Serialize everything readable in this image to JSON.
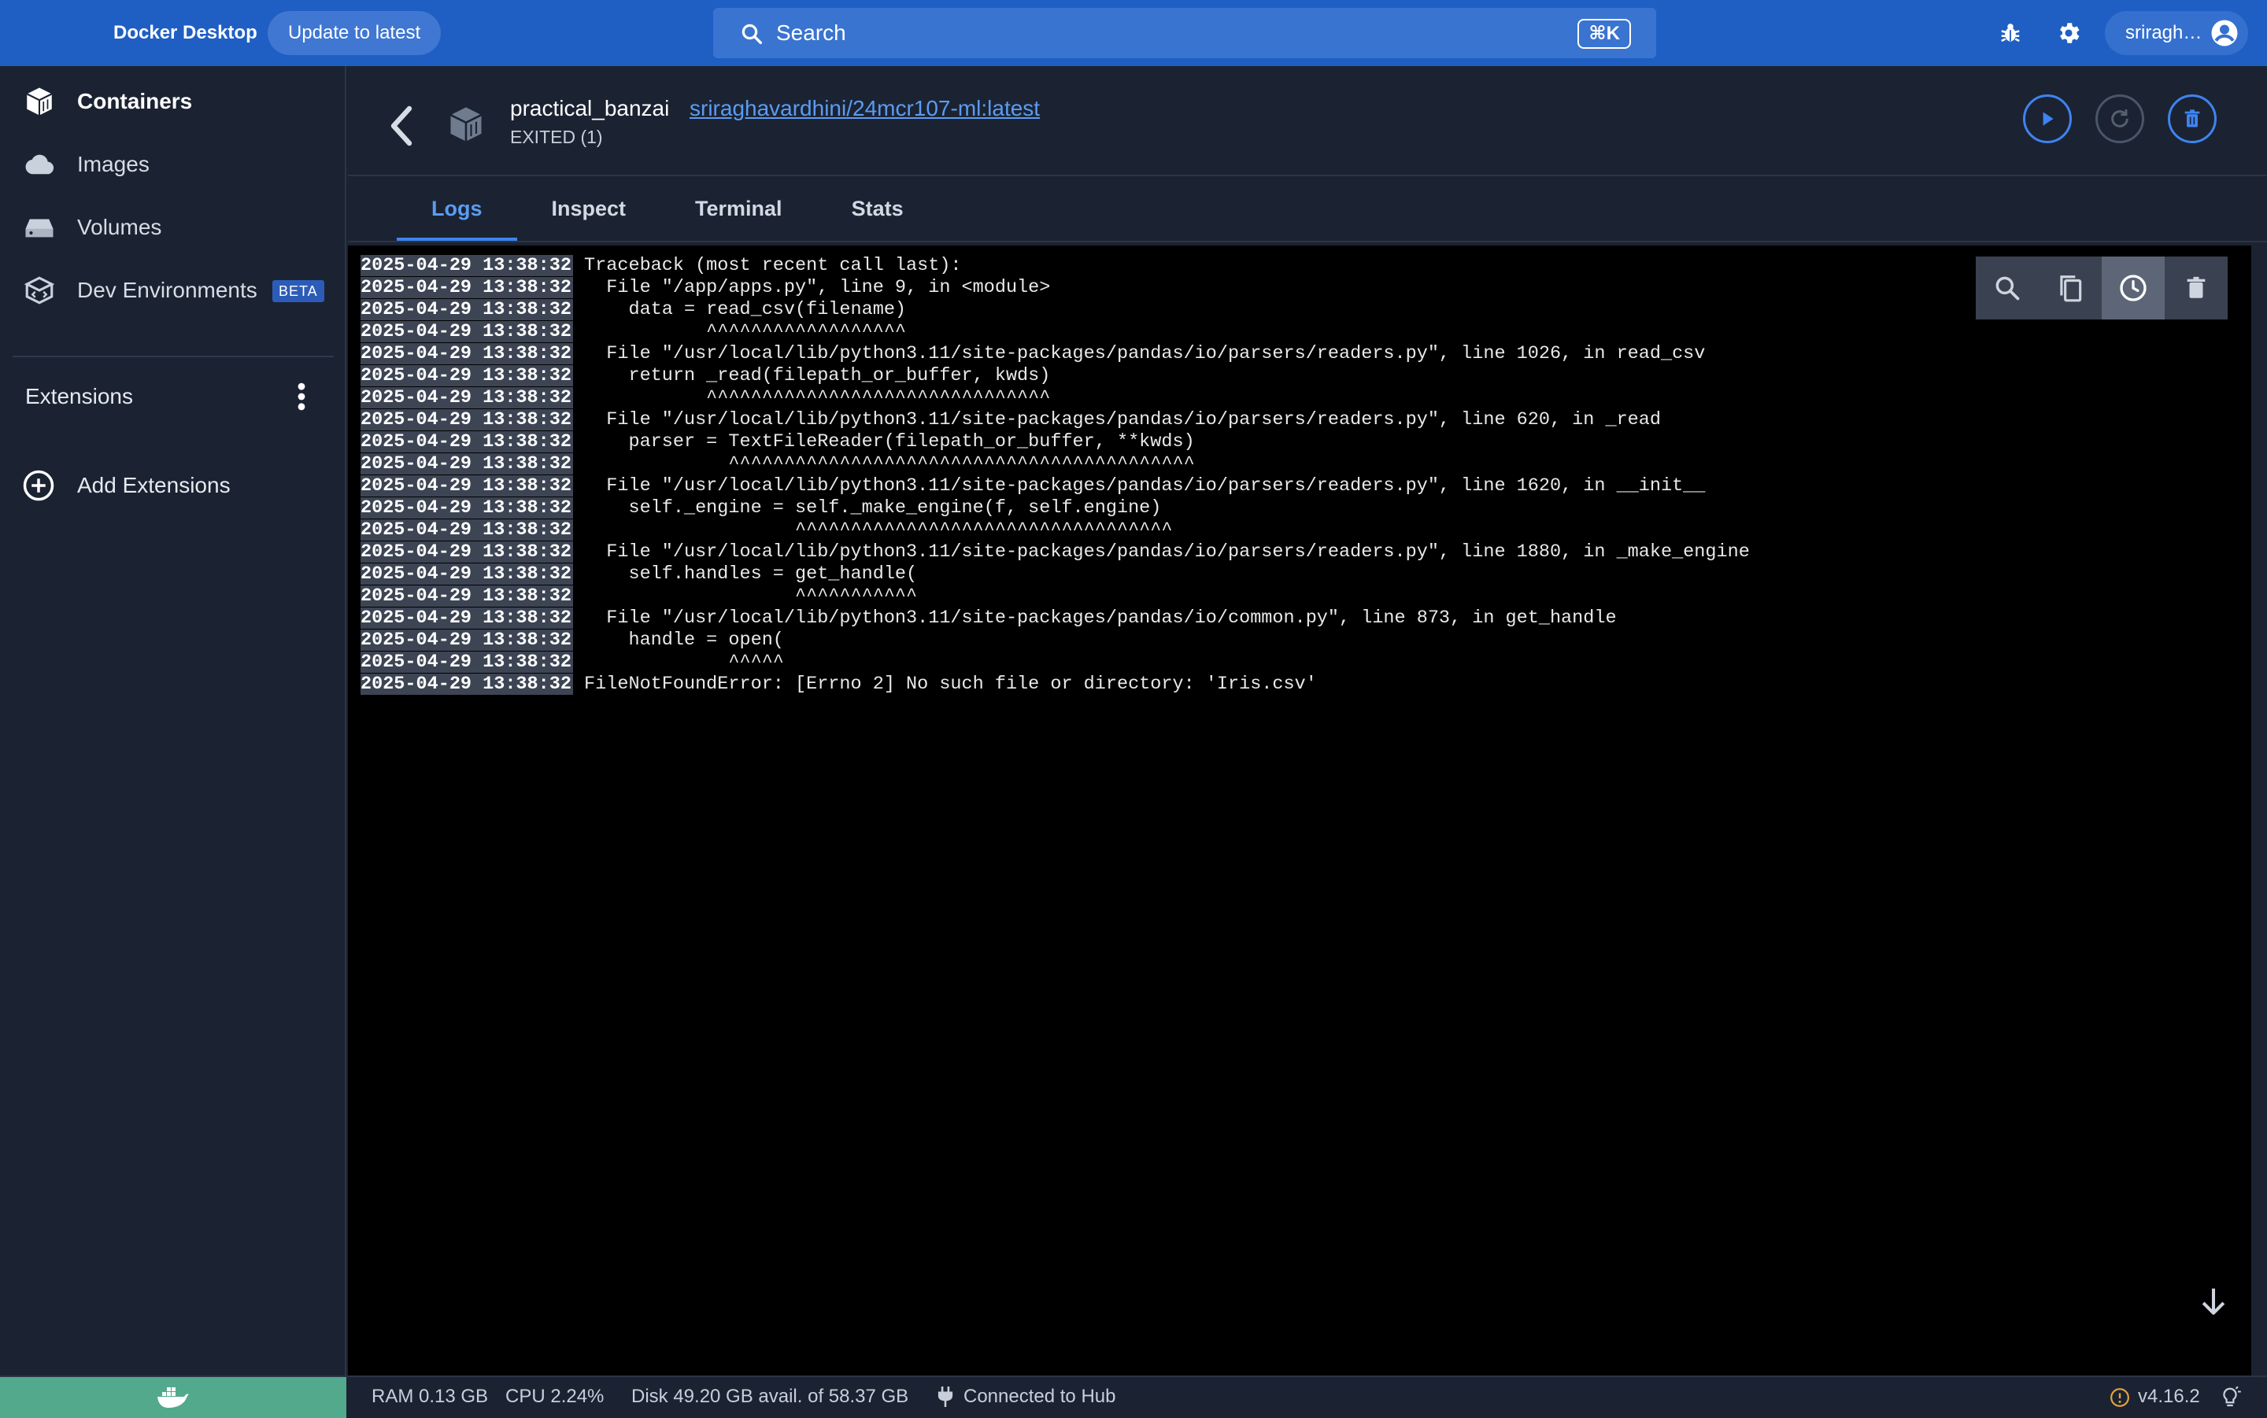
{
  "app": {
    "brand": "Docker Desktop",
    "update_button": "Update to latest",
    "search_placeholder": "Search",
    "search_shortcut": "⌘K",
    "user_name": "sriragh…"
  },
  "sidebar": {
    "items": [
      {
        "label": "Containers",
        "icon": "container-icon",
        "active": true
      },
      {
        "label": "Images",
        "icon": "cloud-icon"
      },
      {
        "label": "Volumes",
        "icon": "volume-icon"
      },
      {
        "label": "Dev Environments",
        "icon": "dev-env-icon",
        "badge": "BETA"
      }
    ],
    "extensions_header": "Extensions",
    "add_extensions": "Add Extensions"
  },
  "container": {
    "name": "practical_banzai",
    "image_link": "sriraghavardhini/24mcr107-ml:latest",
    "status": "EXITED (1)"
  },
  "tabs": [
    "Logs",
    "Inspect",
    "Terminal",
    "Stats"
  ],
  "active_tab": "Logs",
  "logs": [
    {
      "ts": "2025-04-29 13:38:32",
      "text": " Traceback (most recent call last):"
    },
    {
      "ts": "2025-04-29 13:38:32",
      "text": "   File \"/app/apps.py\", line 9, in <module>"
    },
    {
      "ts": "2025-04-29 13:38:32",
      "text": "     data = read_csv(filename)"
    },
    {
      "ts": "2025-04-29 13:38:32",
      "text": "            ^^^^^^^^^^^^^^^^^^"
    },
    {
      "ts": "2025-04-29 13:38:32",
      "text": "   File \"/usr/local/lib/python3.11/site-packages/pandas/io/parsers/readers.py\", line 1026, in read_csv"
    },
    {
      "ts": "2025-04-29 13:38:32",
      "text": "     return _read(filepath_or_buffer, kwds)"
    },
    {
      "ts": "2025-04-29 13:38:32",
      "text": "            ^^^^^^^^^^^^^^^^^^^^^^^^^^^^^^^"
    },
    {
      "ts": "2025-04-29 13:38:32",
      "text": "   File \"/usr/local/lib/python3.11/site-packages/pandas/io/parsers/readers.py\", line 620, in _read"
    },
    {
      "ts": "2025-04-29 13:38:32",
      "text": "     parser = TextFileReader(filepath_or_buffer, **kwds)"
    },
    {
      "ts": "2025-04-29 13:38:32",
      "text": "              ^^^^^^^^^^^^^^^^^^^^^^^^^^^^^^^^^^^^^^^^^^"
    },
    {
      "ts": "2025-04-29 13:38:32",
      "text": "   File \"/usr/local/lib/python3.11/site-packages/pandas/io/parsers/readers.py\", line 1620, in __init__"
    },
    {
      "ts": "2025-04-29 13:38:32",
      "text": "     self._engine = self._make_engine(f, self.engine)"
    },
    {
      "ts": "2025-04-29 13:38:32",
      "text": "                    ^^^^^^^^^^^^^^^^^^^^^^^^^^^^^^^^^^"
    },
    {
      "ts": "2025-04-29 13:38:32",
      "text": "   File \"/usr/local/lib/python3.11/site-packages/pandas/io/parsers/readers.py\", line 1880, in _make_engine"
    },
    {
      "ts": "2025-04-29 13:38:32",
      "text": "     self.handles = get_handle("
    },
    {
      "ts": "2025-04-29 13:38:32",
      "text": "                    ^^^^^^^^^^^"
    },
    {
      "ts": "2025-04-29 13:38:32",
      "text": "   File \"/usr/local/lib/python3.11/site-packages/pandas/io/common.py\", line 873, in get_handle"
    },
    {
      "ts": "2025-04-29 13:38:32",
      "text": "     handle = open("
    },
    {
      "ts": "2025-04-29 13:38:32",
      "text": "              ^^^^^"
    },
    {
      "ts": "2025-04-29 13:38:32",
      "text": " FileNotFoundError: [Errno 2] No such file or directory: 'Iris.csv'"
    }
  ],
  "statusbar": {
    "ram": "RAM 0.13 GB",
    "cpu": "CPU 2.24%",
    "disk": "Disk 49.20 GB avail. of 58.37 GB",
    "hub": "Connected to Hub",
    "version": "v4.16.2"
  },
  "colors": {
    "topbar": "#1f5fc4",
    "accent": "#3f83f0",
    "sidebar_bg": "#1b2332",
    "engine_status": "#52a98c"
  }
}
